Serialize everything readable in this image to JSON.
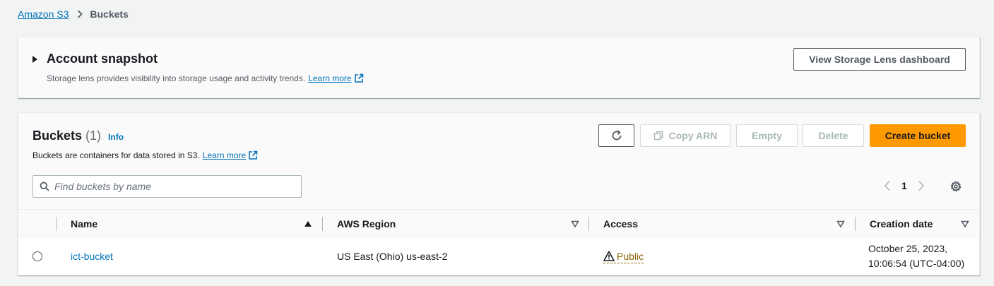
{
  "breadcrumb": {
    "root": "Amazon S3",
    "current": "Buckets"
  },
  "snapshot": {
    "title": "Account snapshot",
    "description": "Storage lens provides visibility into storage usage and activity trends.",
    "learn_more": "Learn more",
    "dashboard_button": "View Storage Lens dashboard"
  },
  "buckets": {
    "title": "Buckets",
    "count": "(1)",
    "info": "Info",
    "description": "Buckets are containers for data stored in S3.",
    "learn_more": "Learn more",
    "actions": {
      "copy_arn": "Copy ARN",
      "empty": "Empty",
      "delete": "Delete",
      "create": "Create bucket"
    },
    "search_placeholder": "Find buckets by name",
    "pagination": {
      "current_page": "1"
    },
    "columns": {
      "name": "Name",
      "region": "AWS Region",
      "access": "Access",
      "created": "Creation date"
    },
    "rows": [
      {
        "name": "ict-bucket",
        "region": "US East (Ohio) us-east-2",
        "access": "Public",
        "created_line1": "October 25, 2023,",
        "created_line2": "10:06:54 (UTC-04:00)"
      }
    ]
  },
  "colors": {
    "link": "#0073bb",
    "primary": "#ff9900",
    "warning": "#8d6605",
    "background": "#f2f3f3"
  }
}
